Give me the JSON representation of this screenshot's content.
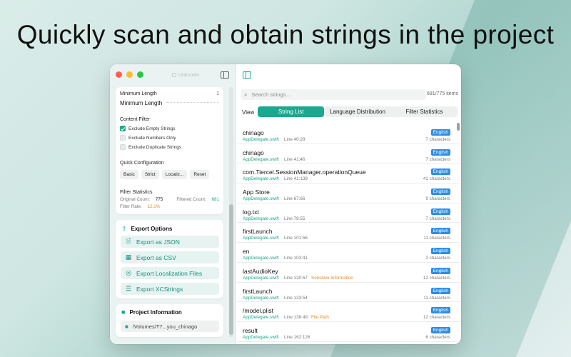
{
  "headline": "Quickly scan and obtain strings in the project",
  "sidebar": {
    "ghost_top_left": "...",
    "ghost_unknown": "Unknown",
    "filter": {
      "min_length_small": "Minimum Length",
      "min_length_value": "1",
      "min_length_label": "Minimum Length",
      "content_filter_title": "Content Filter",
      "checks": [
        {
          "label": "Exclude Empty Strings",
          "checked": true
        },
        {
          "label": "Exclude Numbers Only",
          "checked": false
        },
        {
          "label": "Exclude Duplicate Strings",
          "checked": false
        }
      ],
      "quick_config_title": "Quick Configuration",
      "quick_buttons": [
        "Basic",
        "Strict",
        "Localiz...",
        "Reset"
      ],
      "stats_title": "Filter Statistics",
      "original_count_label": "Original Count:",
      "original_count_value": "775",
      "filtered_count_label": "Filtered Count:",
      "filtered_count_value": "681",
      "filter_rate_label": "Filter Rate:",
      "filter_rate_value": "12.1%"
    },
    "export": {
      "title": "Export Options",
      "buttons": [
        {
          "label": "Export as JSON",
          "icon": "document-icon"
        },
        {
          "label": "Export as CSV",
          "icon": "table-icon"
        },
        {
          "label": "Export Localization Files",
          "icon": "globe-icon"
        },
        {
          "label": "Export XCStrings",
          "icon": "file-code-icon"
        }
      ]
    },
    "project": {
      "title": "Project Information",
      "path": "/Volumes/T7...you_chinago"
    }
  },
  "main": {
    "search_placeholder": "Search strings...",
    "item_count": "681/775 items",
    "view_label": "View",
    "tabs": [
      "String List",
      "Language Distribution",
      "Filter Statistics"
    ],
    "active_tab": 0,
    "rows": [
      {
        "text": "chinago",
        "file": "AppDelegate.swift",
        "line": "Line 40:28",
        "tag": "",
        "lang": "English",
        "chars": "7 characters"
      },
      {
        "text": "chinago",
        "file": "AppDelegate.swift",
        "line": "Line 41:46",
        "tag": "",
        "lang": "English",
        "chars": "7 characters"
      },
      {
        "text": "com.Tiercel.SessionManager.operationQueue",
        "file": "AppDelegate.swift",
        "line": "Line 41:139",
        "tag": "",
        "lang": "English",
        "chars": "41 characters"
      },
      {
        "text": "App Store",
        "file": "AppDelegate.swift",
        "line": "Line 67:66",
        "tag": "",
        "lang": "English",
        "chars": "9 characters"
      },
      {
        "text": "log.txt",
        "file": "AppDelegate.swift",
        "line": "Line 78:55",
        "tag": "",
        "lang": "English",
        "chars": "7 characters"
      },
      {
        "text": "firstLaunch",
        "file": "AppDelegate.swift",
        "line": "Line 101:56",
        "tag": "",
        "lang": "English",
        "chars": "11 characters"
      },
      {
        "text": "en",
        "file": "AppDelegate.swift",
        "line": "Line 103:41",
        "tag": "",
        "lang": "English",
        "chars": "2 characters"
      },
      {
        "text": "lastAudioKey",
        "file": "AppDelegate.swift",
        "line": "Line 120:67",
        "tag": "Sensitive Information",
        "lang": "English",
        "chars": "12 characters"
      },
      {
        "text": "firstLaunch",
        "file": "AppDelegate.swift",
        "line": "Line 133:54",
        "tag": "",
        "lang": "English",
        "chars": "11 characters"
      },
      {
        "text": "/model.plist",
        "file": "AppDelegate.swift",
        "line": "Line 138:49",
        "tag": "File Path",
        "lang": "English",
        "chars": "12 characters"
      },
      {
        "text": "result",
        "file": "AppDelegate.swift",
        "line": "Line 162:126",
        "tag": "",
        "lang": "English",
        "chars": "6 characters"
      }
    ]
  },
  "colors": {
    "accent": "#1aa88f",
    "badge": "#2d8de6",
    "tag_warning": "#e8891e"
  }
}
